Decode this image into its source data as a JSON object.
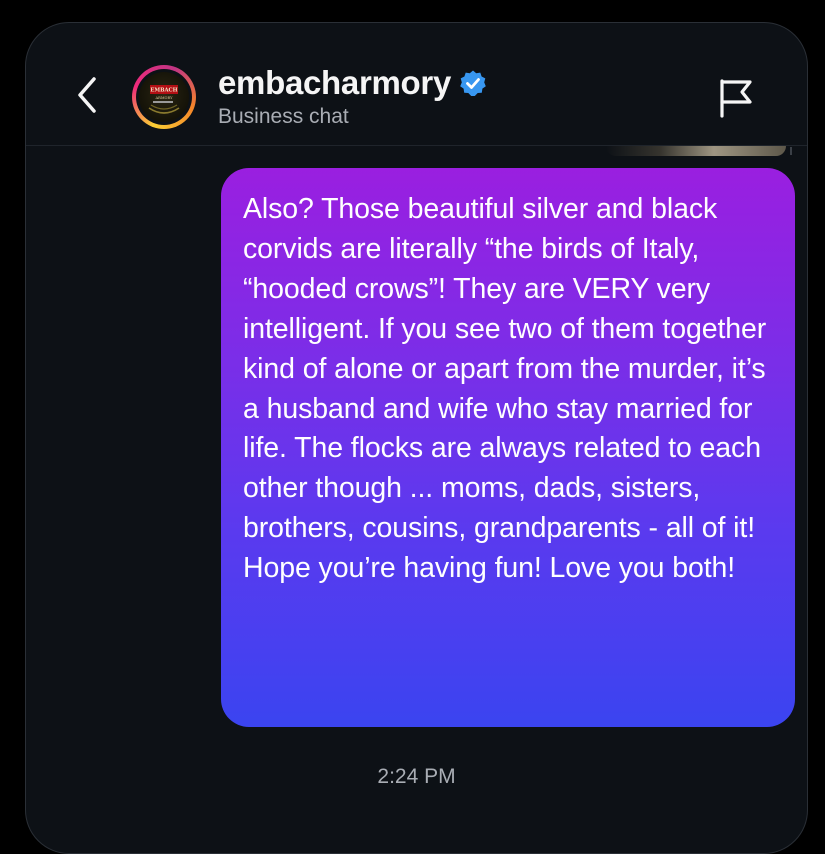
{
  "header": {
    "back_icon": "chevron-left-icon",
    "username": "embacharmory",
    "verified_icon": "verified-badge-icon",
    "subtitle": "Business chat",
    "report_icon": "flag-icon",
    "avatar_logo_text": "EMBACH ARMORY"
  },
  "message": {
    "direction": "outgoing",
    "text": "Also? Those beautiful silver and black corvids are literally “the birds of Italy, “hooded crows”! They are VERY very intelligent. If you see two of them together kind of alone or apart from the murder, it’s a husband and wife who stay married for life. The flocks are always related to each other though ... moms, dads, sisters, brothers, cousins, grandparents - all of it! Hope you’re having fun! Love you both!",
    "timestamp": "2:24 PM"
  },
  "colors": {
    "background": "#0d1116",
    "bubble_top": "#9a1fe0",
    "bubble_bottom": "#3b44f0",
    "verified_badge": "#3897f0",
    "secondary_text": "#a9adb4"
  }
}
